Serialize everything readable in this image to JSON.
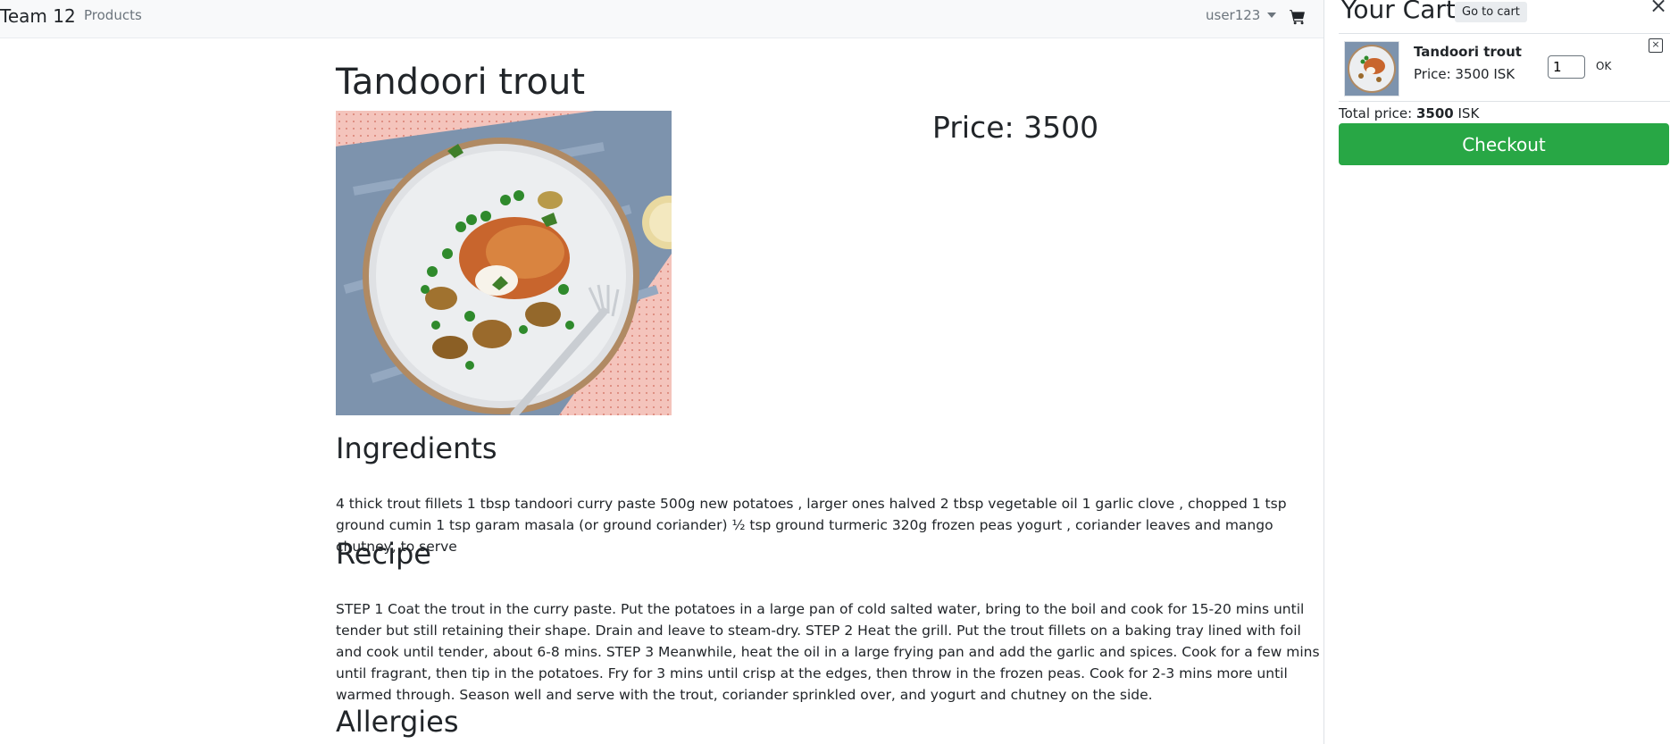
{
  "navbar": {
    "brand": "Team 12",
    "products_link": "Products",
    "username": "user123",
    "cart_icon": "cart-icon"
  },
  "product": {
    "title": "Tandoori trout",
    "price_label": "Price: 3500",
    "ingredients_heading": "Ingredients",
    "ingredients_text": "4 thick trout fillets 1 tbsp tandoori curry paste 500g new potatoes , larger ones halved 2 tbsp vegetable oil 1 garlic clove , chopped 1 tsp ground cumin 1 tsp garam masala (or ground coriander) ½ tsp ground turmeric 320g frozen peas yogurt , coriander leaves and mango chutney, to serve",
    "recipe_heading": "Recipe",
    "recipe_text": "STEP 1 Coat the trout in the curry paste. Put the potatoes in a large pan of cold salted water, bring to the boil and cook for 15-20 mins until tender but still retaining their shape. Drain and leave to steam-dry. STEP 2 Heat the grill. Put the trout fillets on a baking tray lined with foil and cook until tender, about 6-8 mins. STEP 3 Meanwhile, heat the oil in a large frying pan and add the garlic and spices. Cook for a few mins until fragrant, then tip in the potatoes. Fry for 3 mins until crisp at the edges, then throw in the frozen peas. Cook for 2-3 mins more until warmed through. Season well and serve with the trout, coriander sprinkled over, and yogurt and chutney on the side.",
    "allergies_heading": "Allergies"
  },
  "cart": {
    "title": "Your Cart",
    "goto_label": "Go to cart",
    "close_symbol": "×",
    "items": [
      {
        "name": "Tandoori trout",
        "price": "Price: 3500 ISK",
        "quantity": "1",
        "ok_label": "OK",
        "remove_symbol": "×"
      }
    ],
    "total_prefix": "Total price:",
    "total_value": "3500",
    "total_currency": "ISK",
    "checkout_label": "Checkout"
  },
  "colors": {
    "checkout_green": "#28a745",
    "navbar_bg": "#f8f9fa",
    "text_dark": "#212529",
    "text_muted": "#6c757d"
  }
}
